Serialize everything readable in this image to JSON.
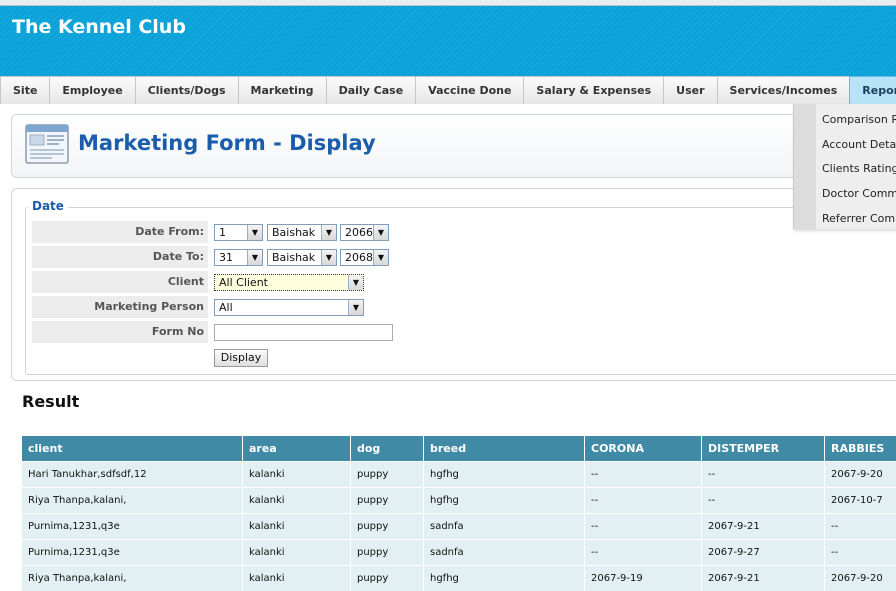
{
  "app": {
    "title": "The Kennel Club"
  },
  "nav": {
    "items": [
      {
        "label": "Site"
      },
      {
        "label": "Employee"
      },
      {
        "label": "Clients/Dogs"
      },
      {
        "label": "Marketing"
      },
      {
        "label": "Daily Case"
      },
      {
        "label": "Vaccine Done"
      },
      {
        "label": "Salary & Expenses"
      },
      {
        "label": "User"
      },
      {
        "label": "Services/Incomes"
      },
      {
        "label": "Reports"
      }
    ],
    "active": "Reports"
  },
  "reports_menu": {
    "items": [
      {
        "label": "Comparison Rep"
      },
      {
        "label": "Account Detail"
      },
      {
        "label": "Clients Ratings"
      },
      {
        "label": "Doctor Commissi"
      },
      {
        "label": "Referrer Commi"
      }
    ]
  },
  "page": {
    "title": "Marketing Form - Display"
  },
  "form": {
    "legend": "Date",
    "date_from": {
      "label": "Date From:",
      "day": "1",
      "month": "Baishak",
      "year": "2066"
    },
    "date_to": {
      "label": "Date To:",
      "day": "31",
      "month": "Baishak",
      "year": "2068"
    },
    "client": {
      "label": "Client",
      "value": "All Client"
    },
    "marketing_person": {
      "label": "Marketing Person",
      "value": "All"
    },
    "form_no": {
      "label": "Form No",
      "value": ""
    },
    "display_button": "Display"
  },
  "result": {
    "heading": "Result",
    "columns": [
      "client",
      "area",
      "dog",
      "breed",
      "CORONA",
      "DISTEMPER",
      "RABBIES"
    ],
    "rows": [
      [
        "Hari Tanukhar,sdfsdf,12",
        "kalanki",
        "puppy",
        "hgfhg",
        "--",
        "--",
        "2067-9-20"
      ],
      [
        "Riya Thanpa,kalani,",
        "kalanki",
        "puppy",
        "hgfhg",
        "--",
        "--",
        "2067-10-7"
      ],
      [
        "Purnima,1231,q3e",
        "kalanki",
        "puppy",
        "sadnfa",
        "--",
        "2067-9-21",
        "--"
      ],
      [
        "Purnima,1231,q3e",
        "kalanki",
        "puppy",
        "sadnfa",
        "--",
        "2067-9-27",
        "--"
      ],
      [
        "Riya Thanpa,kalani,",
        "kalanki",
        "puppy",
        "hgfhg",
        "2067-9-19",
        "2067-9-21",
        "2067-9-20"
      ]
    ]
  },
  "icons": {
    "dropdown_arrow": "chevron-down-icon",
    "page_icon": "form-window-icon"
  }
}
